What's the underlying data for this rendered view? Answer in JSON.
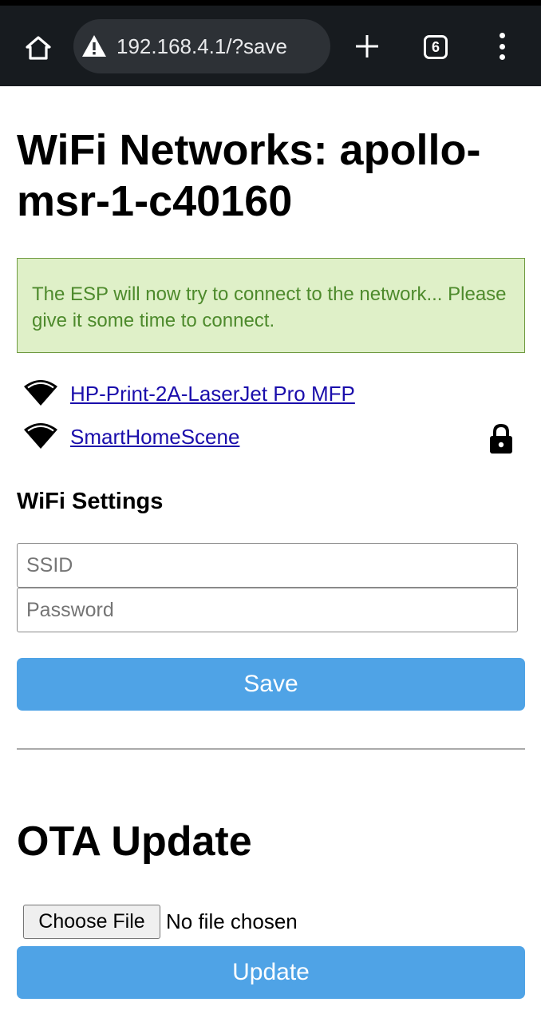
{
  "browser": {
    "url": "192.168.4.1/?save",
    "tab_count": "6"
  },
  "page": {
    "title": "WiFi Networks: apollo-msr-1-c40160",
    "notice": "The ESP will now try to connect to the network... Please give it some time to connect."
  },
  "networks": [
    {
      "ssid": "HP-Print-2A-LaserJet Pro MFP",
      "locked": false
    },
    {
      "ssid": "SmartHomeScene",
      "locked": true
    }
  ],
  "wifi_settings": {
    "heading": "WiFi Settings",
    "ssid_placeholder": "SSID",
    "password_placeholder": "Password",
    "save_label": "Save"
  },
  "ota": {
    "heading": "OTA Update",
    "choose_file_label": "Choose File",
    "file_status": "No file chosen",
    "update_label": "Update"
  },
  "colors": {
    "accent_button": "#4fa3e6",
    "notice_background": "#dff0c8",
    "notice_text": "#4d8a2c",
    "link": "#1a0dab",
    "browser_bar": "#171b1f"
  }
}
